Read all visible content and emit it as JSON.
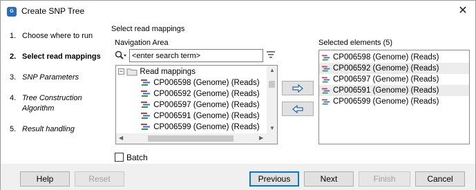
{
  "window": {
    "title": "Create SNP Tree",
    "icon": "app-icon",
    "close_icon": "close-icon"
  },
  "steps": [
    {
      "num": "1.",
      "label": "Choose where to run"
    },
    {
      "num": "2.",
      "label": "Select read mappings"
    },
    {
      "num": "3.",
      "label": "SNP Parameters"
    },
    {
      "num": "4.",
      "label": "Tree Construction Algorithm"
    },
    {
      "num": "5.",
      "label": "Result handling"
    }
  ],
  "main": {
    "section_title": "Select read mappings",
    "nav_label": "Navigation Area",
    "search": {
      "value": "<enter search term>"
    },
    "tree": {
      "folder": "Read mappings",
      "items": [
        "CP006598 (Genome) (Reads)",
        "CP006592 (Genome) (Reads)",
        "CP006597 (Genome) (Reads)",
        "CP006591 (Genome) (Reads)",
        "CP006599 (Genome) (Reads)"
      ]
    },
    "selected_label": "Selected elements (5)",
    "selected": [
      "CP006598 (Genome) (Reads)",
      "CP006592 (Genome) (Reads)",
      "CP006597 (Genome) (Reads)",
      "CP006591 (Genome) (Reads)",
      "CP006599 (Genome) (Reads)"
    ],
    "batch_label": "Batch",
    "batch_checked": false
  },
  "buttons": {
    "help": "Help",
    "reset": "Reset",
    "previous": "Previous",
    "next": "Next",
    "finish": "Finish",
    "cancel": "Cancel"
  },
  "colors": {
    "accent": "#0078d7",
    "move_arrow": "#1f5fbf",
    "read_icon_red": "#d23a3a",
    "read_icon_blue": "#2f6fd0",
    "read_icon_green": "#2f9a3a"
  }
}
